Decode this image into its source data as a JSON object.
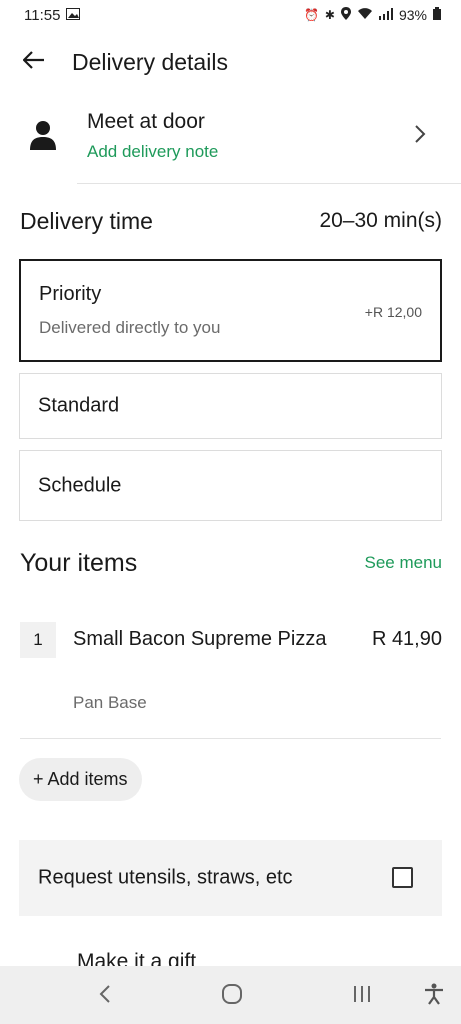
{
  "status_bar": {
    "time": "11:55",
    "battery": "93%"
  },
  "header": {
    "title": "Delivery details"
  },
  "meet": {
    "title": "Meet at door",
    "note": "Add delivery note"
  },
  "delivery_time": {
    "title": "Delivery time",
    "eta": "20–30 min(s)",
    "options": [
      {
        "label": "Priority",
        "sub": "Delivered directly to you",
        "price": "+R 12,00",
        "selected": true
      },
      {
        "label": "Standard"
      },
      {
        "label": "Schedule"
      }
    ]
  },
  "items": {
    "title": "Your items",
    "see_menu": "See menu",
    "list": [
      {
        "qty": "1",
        "name": "Small Bacon Supreme Pizza",
        "price": "R 41,90",
        "modifier": "Pan Base"
      }
    ],
    "add_label": "+ Add items"
  },
  "utensils": {
    "label": "Request utensils, straws, etc",
    "checked": false
  },
  "gift": {
    "label": "Make it a gift"
  },
  "colors": {
    "accent_green": "#1e9a5a",
    "text": "#1a1a1a",
    "muted": "#6b6b6b"
  },
  "icons": {
    "back": "arrow-left-icon",
    "person": "person-icon",
    "chevron": "chevron-right-icon",
    "nav_back": "chevron-left-icon",
    "nav_home": "home-circle-icon",
    "nav_recents": "recents-icon",
    "nav_accessibility": "accessibility-icon"
  }
}
